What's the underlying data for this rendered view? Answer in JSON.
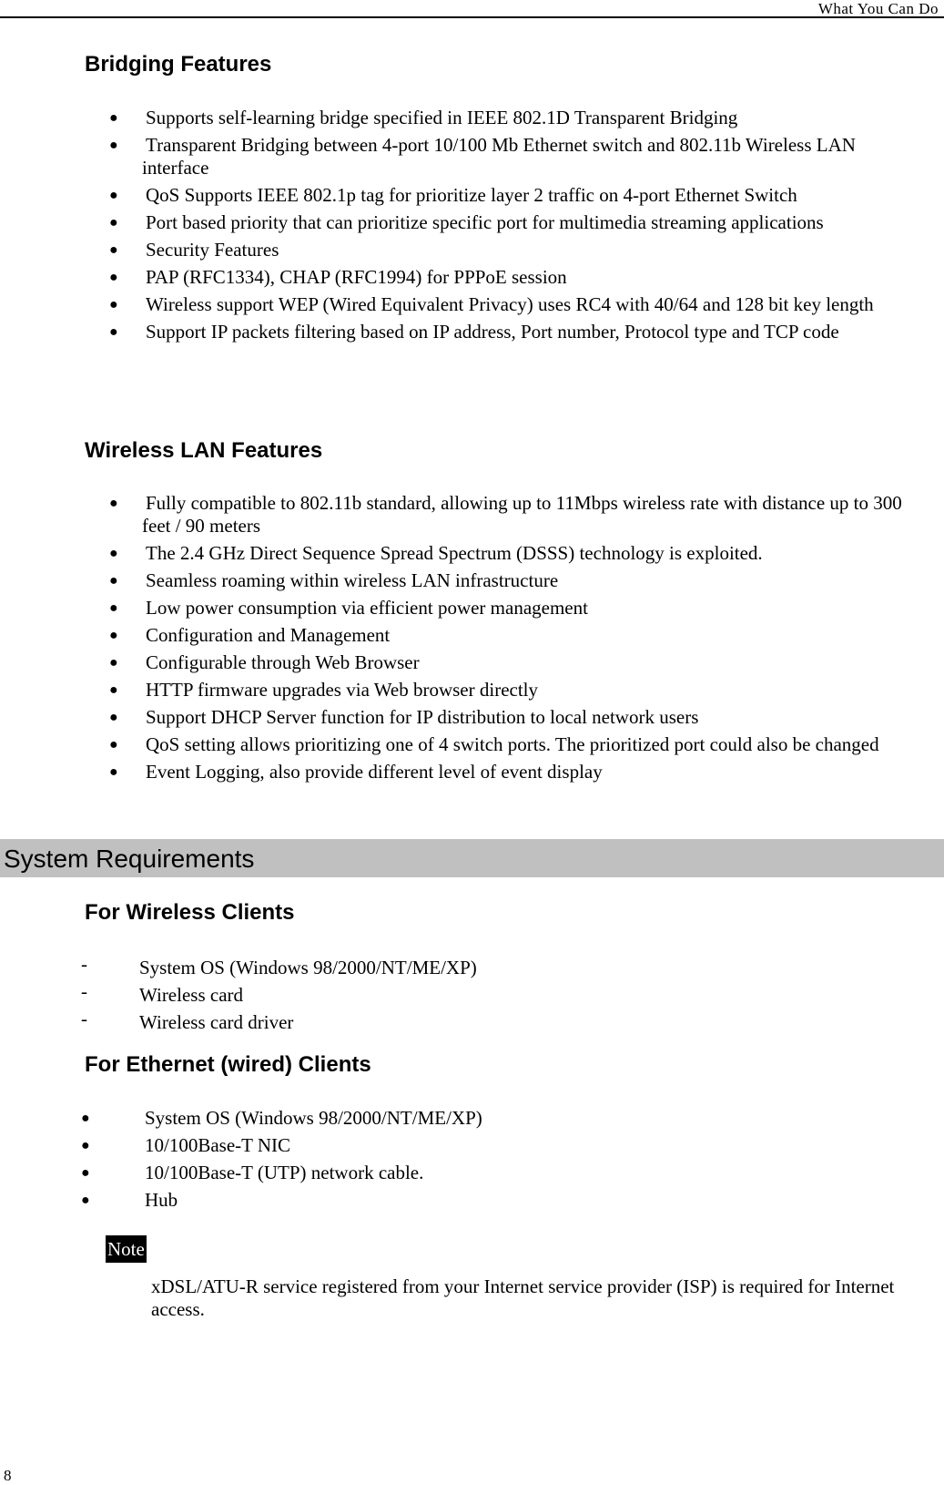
{
  "header": {
    "running_title": "What You Can Do"
  },
  "bridging": {
    "title": "Bridging Features",
    "items": [
      "Supports self-learning bridge specified in IEEE 802.1D Transparent Bridging",
      "Transparent Bridging between 4-port 10/100 Mb Ethernet switch and 802.11b Wireless LAN interface",
      "QoS Supports IEEE 802.1p tag for prioritize layer 2 traffic on 4-port Ethernet Switch",
      "Port based priority that can prioritize specific port for multimedia streaming applications",
      "Security Features",
      "PAP (RFC1334), CHAP (RFC1994) for PPPoE session",
      "Wireless support WEP (Wired Equivalent Privacy) uses RC4 with 40/64 and 128 bit key length",
      "Support IP packets filtering based on IP address, Port number, Protocol type and TCP code"
    ]
  },
  "wireless": {
    "title": "Wireless LAN Features",
    "items": [
      "Fully compatible to 802.11b standard, allowing up to 11Mbps wireless rate with distance up to 300 feet / 90 meters",
      "The 2.4 GHz Direct Sequence Spread Spectrum (DSSS) technology is exploited.",
      "Seamless roaming within wireless LAN infrastructure",
      "Low power consumption via efficient power management",
      "Configuration and Management",
      "Configurable through Web Browser",
      "HTTP firmware upgrades via Web browser directly",
      "Support DHCP Server function for IP distribution to local network users",
      "QoS setting allows prioritizing one of 4 switch ports. The prioritized port could also be changed",
      "Event Logging, also provide different level of event display"
    ]
  },
  "system_requirements": {
    "title": "System Requirements",
    "wireless_clients": {
      "title": "For Wireless Clients",
      "marker": "-",
      "items": [
        "System OS (Windows 98/2000/NT/ME/XP)",
        "Wireless card",
        "Wireless card driver"
      ]
    },
    "ethernet_clients": {
      "title": "For Ethernet (wired) Clients",
      "marker": "●",
      "items": [
        "System OS (Windows 98/2000/NT/ME/XP)",
        "10/100Base-T NIC",
        "10/100Base-T (UTP) network cable.",
        "Hub"
      ]
    }
  },
  "note": {
    "label": "Note",
    "text": "xDSL/ATU-R service registered from your Internet service provider (ISP) is required for Internet access."
  },
  "footer": {
    "page_number": "8"
  },
  "bullet_glyph": "●"
}
